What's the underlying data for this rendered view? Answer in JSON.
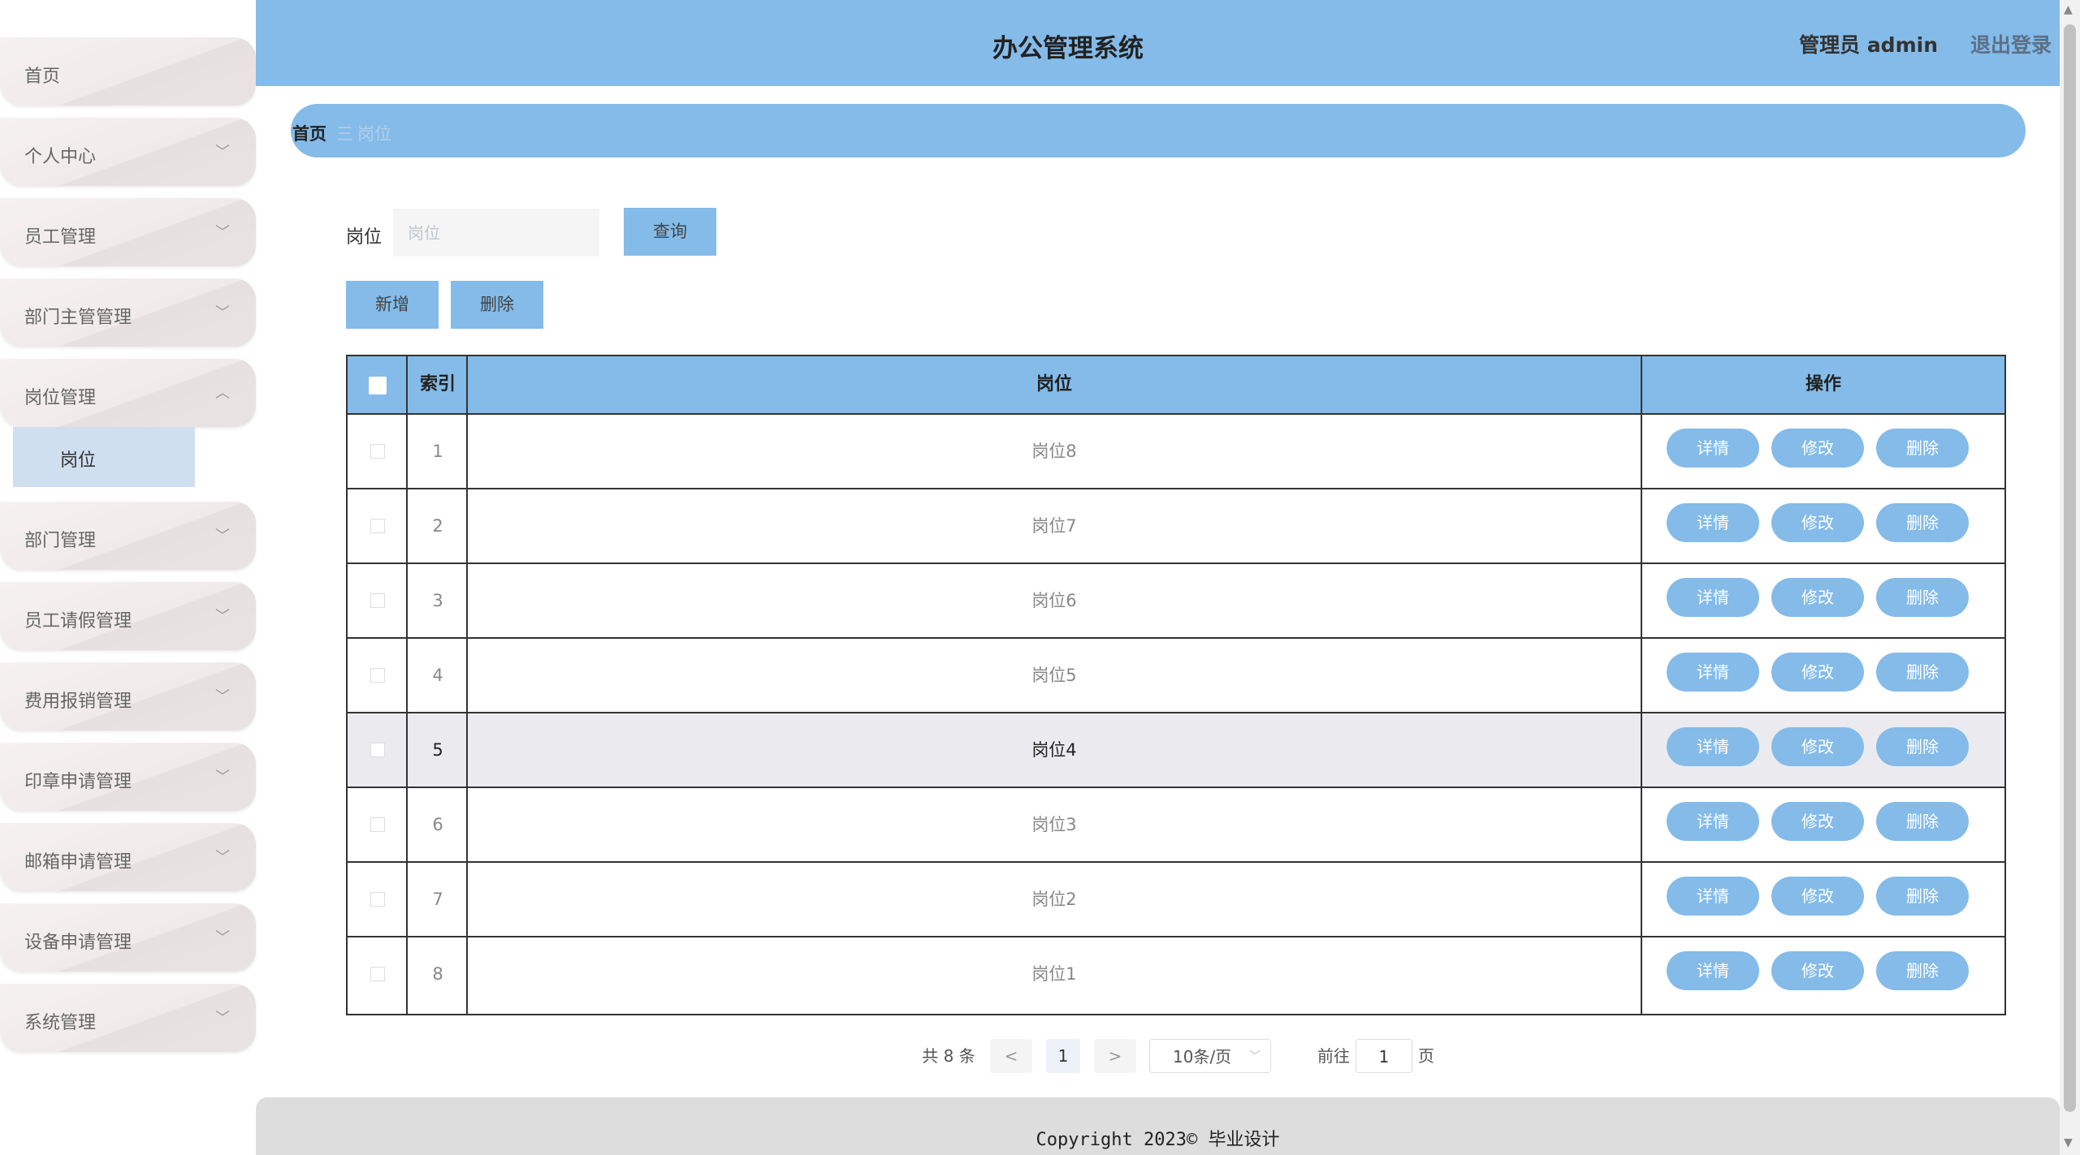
{
  "sidebar": {
    "items": [
      {
        "label": "首页"
      },
      {
        "label": "个人中心"
      },
      {
        "label": "员工管理"
      },
      {
        "label": "部门主管管理"
      },
      {
        "label": "岗位管理"
      },
      {
        "label": "部门管理"
      },
      {
        "label": "员工请假管理"
      },
      {
        "label": "费用报销管理"
      },
      {
        "label": "印章申请管理"
      },
      {
        "label": "邮箱申请管理"
      },
      {
        "label": "设备申请管理"
      },
      {
        "label": "系统管理"
      }
    ],
    "sub_item": "岗位",
    "chevron_down": "﹀",
    "chevron_up": "︿"
  },
  "header": {
    "title": "办公管理系统",
    "user": "管理员 admin",
    "logout": "退出登录"
  },
  "breadcrumb": {
    "home": "首页",
    "separator": "三",
    "current": "岗位"
  },
  "search": {
    "label": "岗位",
    "placeholder": "岗位",
    "query_button": "查询"
  },
  "actions": {
    "add_button": "新增",
    "delete_button": "删除"
  },
  "table": {
    "headers": {
      "index": "索引",
      "position": "岗位",
      "ops": "操作"
    },
    "rows": [
      {
        "index": "1",
        "position": "岗位8"
      },
      {
        "index": "2",
        "position": "岗位7"
      },
      {
        "index": "3",
        "position": "岗位6"
      },
      {
        "index": "4",
        "position": "岗位5"
      },
      {
        "index": "5",
        "position": "岗位4"
      },
      {
        "index": "6",
        "position": "岗位3"
      },
      {
        "index": "7",
        "position": "岗位2"
      },
      {
        "index": "8",
        "position": "岗位1"
      }
    ],
    "row_buttons": {
      "detail": "详情",
      "edit": "修改",
      "delete": "删除"
    }
  },
  "pagination": {
    "total": "共 8 条",
    "prev": "<",
    "page": "1",
    "next": ">",
    "page_size": "10条/页",
    "goto_prefix": "前往",
    "goto_value": "1",
    "goto_suffix": "页"
  },
  "footer": {
    "copyright": "Copyright 2023© 毕业设计"
  },
  "colors": {
    "accent": "#84bbe8",
    "sidebar_sub_bg": "#cfdff0",
    "footer_bg": "#dddddd"
  }
}
